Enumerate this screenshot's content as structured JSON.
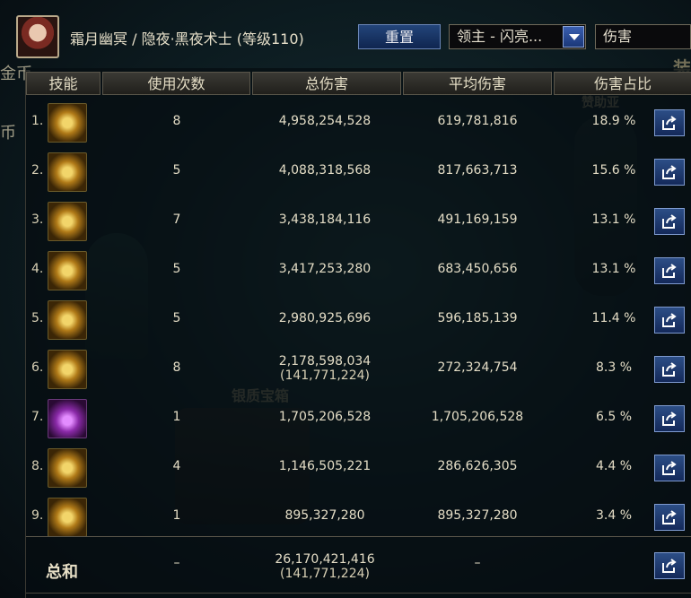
{
  "header": {
    "character_name": "霜月幽冥 / 隐夜·黑夜术士 (等级110)",
    "reset_label": "重置",
    "boss_select_value": "领主 - 闪亮...",
    "metric_select_value": "伤害"
  },
  "columns": {
    "skill": "技能",
    "uses": "使用次数",
    "total": "总伤害",
    "avg": "平均伤害",
    "pct": "伤害占比"
  },
  "rows": [
    {
      "idx": "1.",
      "uses": "8",
      "total": "4,958,254,528",
      "total_sub": "",
      "avg": "619,781,816",
      "pct": "18.9 %"
    },
    {
      "idx": "2.",
      "uses": "5",
      "total": "4,088,318,568",
      "total_sub": "",
      "avg": "817,663,713",
      "pct": "15.6 %"
    },
    {
      "idx": "3.",
      "uses": "7",
      "total": "3,438,184,116",
      "total_sub": "",
      "avg": "491,169,159",
      "pct": "13.1 %"
    },
    {
      "idx": "4.",
      "uses": "5",
      "total": "3,417,253,280",
      "total_sub": "",
      "avg": "683,450,656",
      "pct": "13.1 %"
    },
    {
      "idx": "5.",
      "uses": "5",
      "total": "2,980,925,696",
      "total_sub": "",
      "avg": "596,185,139",
      "pct": "11.4 %"
    },
    {
      "idx": "6.",
      "uses": "8",
      "total": "2,178,598,034",
      "total_sub": "(141,771,224)",
      "avg": "272,324,754",
      "pct": "8.3 %"
    },
    {
      "idx": "7.",
      "uses": "1",
      "total": "1,705,206,528",
      "total_sub": "",
      "avg": "1,705,206,528",
      "pct": "6.5 %"
    },
    {
      "idx": "8.",
      "uses": "4",
      "total": "1,146,505,221",
      "total_sub": "",
      "avg": "286,626,305",
      "pct": "4.4 %"
    },
    {
      "idx": "9.",
      "uses": "1",
      "total": "895,327,280",
      "total_sub": "",
      "avg": "895,327,280",
      "pct": "3.4 %"
    }
  ],
  "summary": {
    "label": "总和",
    "uses": "–",
    "total": "26,170,421,416",
    "total_sub": "(141,771,224)",
    "avg": "–"
  },
  "background_text": {
    "left_top": "金币",
    "left_mid": "币",
    "silver_chest": "银质宝箱",
    "right_label": "赞助亚",
    "right_corner": "装"
  },
  "icons": {
    "skills": [
      "gold-wave-icon",
      "gold-flare-icon",
      "gold-chain-icon",
      "gold-claw-icon",
      "gold-face-icon",
      "gold-burst-icon",
      "purple-pillar-icon",
      "gold-cross-icon",
      "gold-hands-icon"
    ],
    "share": "share-icon"
  },
  "colors": {
    "button_blue": "#23457a",
    "text_gold": "#e3dcc4"
  }
}
